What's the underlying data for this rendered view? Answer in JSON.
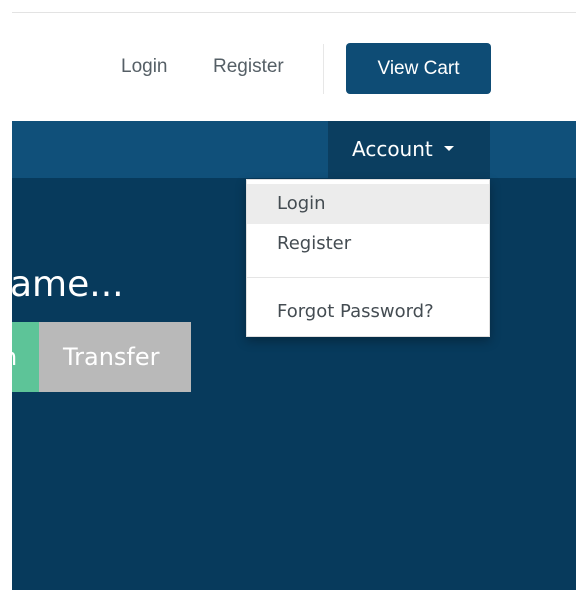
{
  "header": {
    "login_label": "Login",
    "register_label": "Register",
    "view_cart_label": "View Cart"
  },
  "navbar": {
    "account_label": "Account"
  },
  "dropdown": {
    "items": [
      {
        "label": "Login"
      },
      {
        "label": "Register"
      },
      {
        "label": "Forgot Password?"
      }
    ]
  },
  "hero": {
    "heading": "ame...",
    "green_button_label": "n",
    "transfer_label": "Transfer"
  },
  "colors": {
    "brand_blue": "#0e4c75",
    "navbar_blue": "#10507a",
    "hero_blue": "#073a5c",
    "green_button": "#5dc498",
    "gray_button": "#b9b9b9"
  }
}
